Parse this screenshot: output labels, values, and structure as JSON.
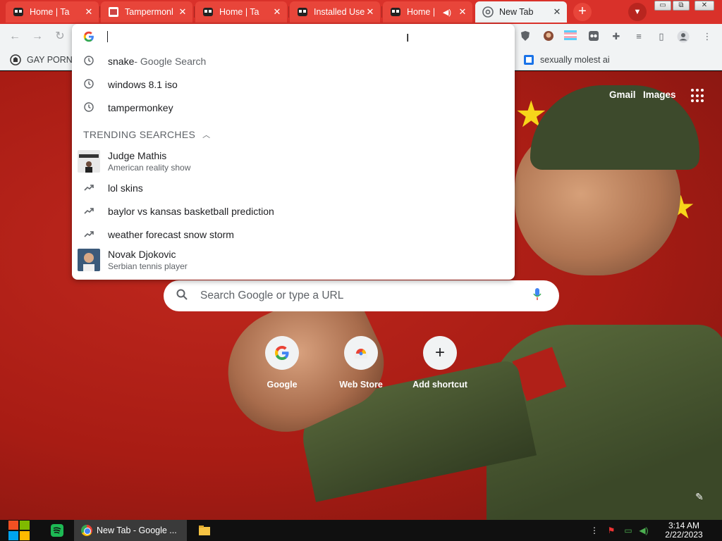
{
  "tabs": [
    {
      "title": "Home | Ta",
      "close": "✕"
    },
    {
      "title": "Tampermonl",
      "close": "✕"
    },
    {
      "title": "Home | Ta",
      "close": "✕"
    },
    {
      "title": "Installed Use",
      "close": "✕"
    },
    {
      "title": "Home |",
      "close": "✕"
    },
    {
      "title": "New Tab",
      "close": "✕"
    }
  ],
  "tab_controls": {
    "new_tab": "+",
    "search_tabs": "▼"
  },
  "window": {
    "minimize": "▭",
    "restore": "⧉",
    "close": "✕"
  },
  "bookmarks": [
    {
      "label": "GAY PORN"
    },
    {
      "label": "sexually molest ai"
    }
  ],
  "omnibox": {
    "value": "",
    "suggestions": [
      {
        "text": "snake",
        "sub": " - Google Search",
        "icon": "history-icon"
      },
      {
        "text": "windows 8.1 iso",
        "sub": "",
        "icon": "history-icon"
      },
      {
        "text": "tampermonkey",
        "sub": "",
        "icon": "history-icon"
      }
    ],
    "trending_header": "TRENDING SEARCHES",
    "trending": [
      {
        "title": "Judge Mathis",
        "subtitle": "American reality show",
        "type": "entity"
      },
      {
        "title": "lol skins",
        "type": "trend"
      },
      {
        "title": "baylor vs kansas basketball prediction",
        "type": "trend"
      },
      {
        "title": "weather forecast snow storm",
        "type": "trend"
      },
      {
        "title": "Novak Djokovic",
        "subtitle": "Serbian tennis player",
        "type": "entity"
      }
    ]
  },
  "ntp": {
    "gmail": "Gmail",
    "images": "Images",
    "search_placeholder": "Search Google or type a URL",
    "shortcuts": [
      {
        "label": "Google"
      },
      {
        "label": "Web Store"
      },
      {
        "label": "Add shortcut"
      }
    ]
  },
  "taskbar": {
    "task_title": "New Tab - Google ...",
    "time": "3:14 AM",
    "date": "2/22/2023"
  },
  "colors": {
    "tab_strip": "#d9312a",
    "active_tab": "#f1f3f4",
    "background_red": "#b3221a",
    "star_yellow": "#f7d61a",
    "accent_blue": "#1a73e8"
  }
}
